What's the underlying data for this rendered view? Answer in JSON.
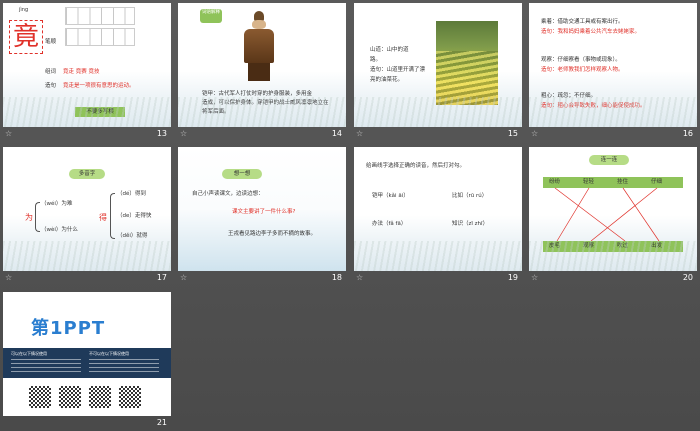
{
  "slides": {
    "s13": {
      "num": "13",
      "pinyin": "jìng",
      "char": "竟",
      "stroke_label": "笔顺",
      "words_label": "组词",
      "words": "竟走 竟赛 竟技",
      "sentence_label": "造句",
      "sentence": "竟走是一项很有意思的运动。",
      "tip": "不要多写横"
    },
    "s14": {
      "num": "14",
      "badge": "词语解释",
      "text1": "铠甲：古代军人打仗时穿的护身服装，多用金",
      "text2": "造成，可以保护身体。穿铠甲的战士威风凛凛地立在",
      "text3": "将军后面。"
    },
    "s15": {
      "num": "15",
      "line1": "山道：山中的道",
      "line2": "路。",
      "line3": "造句：山道里开满了漂",
      "line4": "亮的油菜花。"
    },
    "s16": {
      "num": "16",
      "l1": "乘着：借助交通工具或有案出行。",
      "l2": "造句：我和妈妈乘着公共汽车去姥姥家。",
      "l3": "观察：仔细察看（事物或现象）。",
      "l4": "造句：老师教我们怎样观察人物。",
      "l5": "粗心：疏忽；不仔细。",
      "l6": "造句：粗心会导致失败，细心能促使成功。"
    },
    "s17": {
      "num": "17",
      "title": "多音字",
      "c1": "为",
      "c1a": "（wéi）为难",
      "c1b": "（wèi）为什么",
      "c2": "得",
      "c2a": "（dé）得到",
      "c2b": "（de）走得快",
      "c2c": "（děi）就得"
    },
    "s18": {
      "num": "18",
      "title": "想一想",
      "l1": "自己小声读课文，边读边想：",
      "q": "课文主要讲了一件什么事?",
      "a": "王戎看见路边李子多而不摘的故事。"
    },
    "s19": {
      "num": "19",
      "title": "给画线字选择正确的读音，然后打对勾。",
      "i1": "铠甲（kǎi āi）",
      "i2": "比如（rū rú）",
      "i3": "办法（fǎ fā）",
      "i4": "知识（zī zhī）"
    },
    "s20": {
      "num": "20",
      "title": "连一连",
      "top": [
        "纷纷",
        "轻轻",
        "挂住",
        "仔细"
      ],
      "bottom": [
        "皮毛",
        "观察",
        "吹过",
        "出发"
      ]
    },
    "s21": {
      "num": "21",
      "logo": "第1PPT",
      "left_head": "可以在以下情况使用",
      "right_head": "不可以在以下情况使用"
    }
  },
  "colors": {
    "accent_green": "#8fc35a",
    "accent_red": "#e0312a",
    "bg": "#555555"
  }
}
